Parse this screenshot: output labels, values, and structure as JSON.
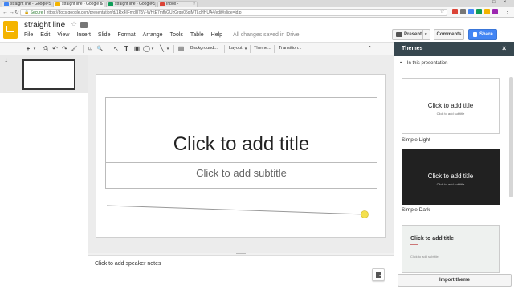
{
  "browser": {
    "tabs": [
      {
        "label": "straight line - Google S",
        "active": false,
        "color": "#4285f4"
      },
      {
        "label": "straight line - Google S",
        "active": true,
        "color": "#f4b400"
      },
      {
        "label": "straight line - Google S",
        "active": false,
        "color": "#0f9d58"
      },
      {
        "label": "Inbox -",
        "active": false,
        "color": "#db4437"
      }
    ],
    "close_glyph": "×",
    "window_controls": [
      "–",
      "□",
      "×"
    ],
    "nav": {
      "back": "←",
      "forward": "→",
      "reload": "↻"
    },
    "address": {
      "lock": "🔒",
      "secure_label": "Secure",
      "url": "https://docs.google.com/presentation/d/1Rx4llFmdUT5V-WHtE7mfhGUzGrgp05qjMTLcHHUA4/edit#slide=id.p"
    },
    "star_glyph": "☆",
    "menu_glyph": "⋮"
  },
  "doc": {
    "title": "straight line",
    "star_glyph": "☆",
    "menus": [
      "File",
      "Edit",
      "View",
      "Insert",
      "Slide",
      "Format",
      "Arrange",
      "Tools",
      "Table",
      "Help"
    ],
    "saved_status": "All changes saved in Drive",
    "present_label": "Present",
    "present_caret": "▾",
    "comments_label": "Comments",
    "share_label": "Share"
  },
  "toolbar": {
    "new_slide": "+",
    "caret": "▾",
    "print": "⎙",
    "undo": "↶",
    "redo": "↷",
    "paint": "🖌",
    "zoom": "🔍",
    "select": "↖",
    "textbox": "T",
    "image": "▣",
    "shape": "◯",
    "line": "╲",
    "comment": "▤",
    "background_label": "Background...",
    "layout_label": "Layout",
    "theme_label": "Theme...",
    "transition_label": "Transition...",
    "collapse": "⌃"
  },
  "filmstrip": {
    "slide_number": "1"
  },
  "slide": {
    "title_placeholder": "Click to add title",
    "subtitle_placeholder": "Click to add subtitle",
    "line_color": "#999999",
    "handle_color": "#f4e04d"
  },
  "notes": {
    "placeholder": "Click to add speaker notes",
    "add_glyph": "+"
  },
  "themes_panel": {
    "title": "Themes",
    "close_glyph": "×",
    "section_bullet": "•",
    "section_label": "In this presentation",
    "themes": [
      {
        "name": "Simple Light",
        "preview_title": "Click to add title",
        "preview_subtitle": "Click to add subtitle",
        "bg": "#ffffff",
        "fg": "#222222"
      },
      {
        "name": "Simple Dark",
        "preview_title": "Click to add title",
        "preview_subtitle": "Click to add subtitle",
        "bg": "#212121",
        "fg": "#ffffff"
      },
      {
        "name": "",
        "preview_title": "Click to add title",
        "preview_subtitle": "Click to add subtitle",
        "bg": "#eef1ef",
        "fg": "#333333"
      }
    ],
    "import_label": "Import theme"
  }
}
